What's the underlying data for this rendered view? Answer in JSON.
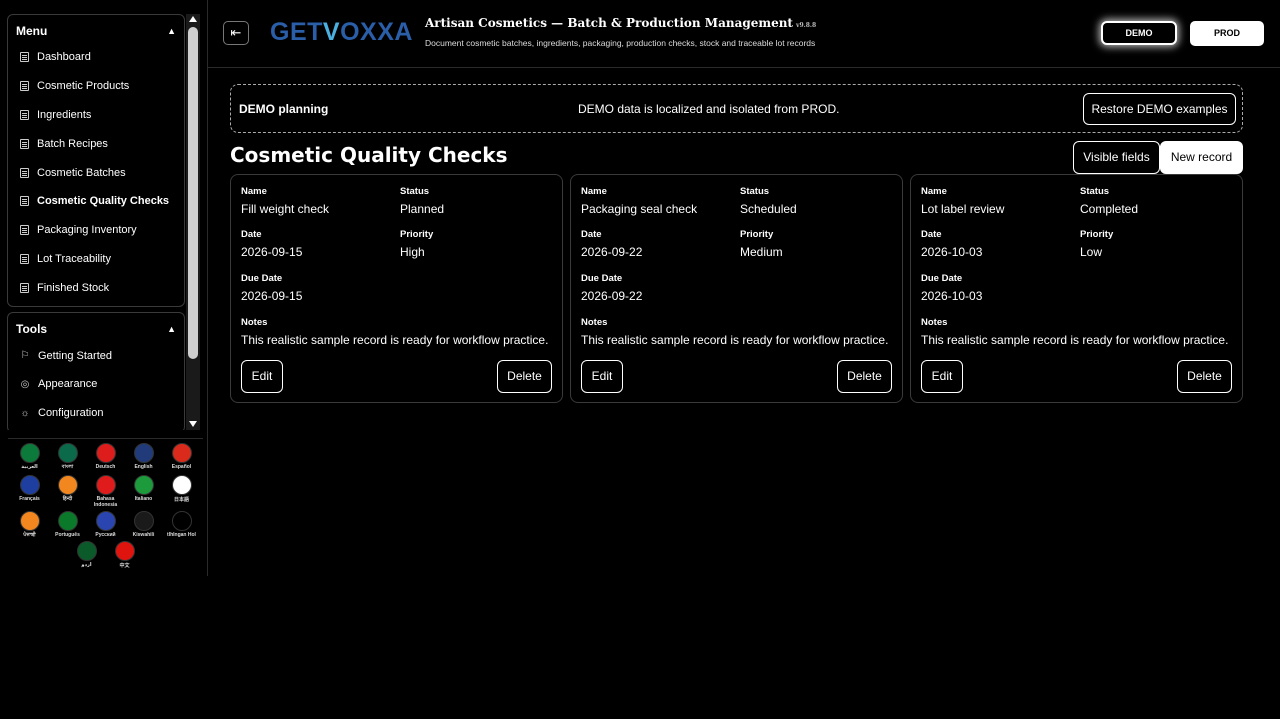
{
  "sidebar": {
    "menu_title": "Menu",
    "menu_items": [
      {
        "label": "Dashboard"
      },
      {
        "label": "Cosmetic Products"
      },
      {
        "label": "Ingredients"
      },
      {
        "label": "Batch Recipes"
      },
      {
        "label": "Cosmetic Batches"
      },
      {
        "label": "Cosmetic Quality Checks",
        "active": true
      },
      {
        "label": "Packaging Inventory"
      },
      {
        "label": "Lot Traceability"
      },
      {
        "label": "Finished Stock"
      }
    ],
    "tools_title": "Tools",
    "tools_items": [
      {
        "label": "Getting Started",
        "icon": "flag-icon"
      },
      {
        "label": "Appearance",
        "icon": "palette-icon"
      },
      {
        "label": "Configuration",
        "icon": "gear-icon"
      }
    ],
    "languages": [
      [
        {
          "label": "العربية",
          "color": "#0b7a3a"
        },
        {
          "label": "বাংলা",
          "color": "#0a6a4a"
        },
        {
          "label": "Deutsch",
          "color": "#dd1c1c"
        },
        {
          "label": "English",
          "color": "#203a7a"
        },
        {
          "label": "Español",
          "color": "#d92a1c"
        }
      ],
      [
        {
          "label": "Français",
          "color": "#1f3fa0"
        },
        {
          "label": "हिन्दी",
          "color": "#f2871f"
        },
        {
          "label": "Bahasa Indonesia",
          "color": "#e01b1b"
        },
        {
          "label": "Italiano",
          "color": "#1c9a3c"
        },
        {
          "label": "日本語",
          "color": "#ffffff"
        }
      ],
      [
        {
          "label": "ਪੰਜਾਬੀ",
          "color": "#f2871f"
        },
        {
          "label": "Português",
          "color": "#0a7a2a"
        },
        {
          "label": "Русский",
          "color": "#2a45b0"
        },
        {
          "label": "Kiswahili",
          "color": "#1a1a1a"
        },
        {
          "label": "tlhIngan Hol",
          "color": "#000000"
        }
      ],
      [
        {
          "label": "اردو",
          "color": "#0b5a2a"
        },
        {
          "label": "中文",
          "color": "#e0140f"
        }
      ]
    ]
  },
  "header": {
    "logo_get": "GET",
    "logo_v": "V",
    "logo_oxxa": "OXXA",
    "title": "Artisan Cosmetics — Batch & Production Management",
    "version": "v9.8.8",
    "subtitle": "Document cosmetic batches, ingredients, packaging, production checks, stock and traceable lot records",
    "env_demo": "DEMO",
    "env_prod": "PROD"
  },
  "banner": {
    "title": "DEMO planning",
    "message": "DEMO data is localized and isolated from PROD.",
    "restore_label": "Restore DEMO examples"
  },
  "main": {
    "title": "Cosmetic Quality Checks",
    "visible_fields_label": "Visible fields",
    "new_record_label": "New record"
  },
  "labels": {
    "name": "Name",
    "status": "Status",
    "date": "Date",
    "priority": "Priority",
    "due_date": "Due Date",
    "notes": "Notes",
    "edit": "Edit",
    "delete": "Delete"
  },
  "records": [
    {
      "name": "Fill weight check",
      "status": "Planned",
      "date": "2026-09-15",
      "priority": "High",
      "due_date": "2026-09-15",
      "notes": "This realistic sample record is ready for workflow practice."
    },
    {
      "name": "Packaging seal check",
      "status": "Scheduled",
      "date": "2026-09-22",
      "priority": "Medium",
      "due_date": "2026-09-22",
      "notes": "This realistic sample record is ready for workflow practice."
    },
    {
      "name": "Lot label review",
      "status": "Completed",
      "date": "2026-10-03",
      "priority": "Low",
      "due_date": "2026-10-03",
      "notes": "This realistic sample record is ready for workflow practice."
    }
  ]
}
